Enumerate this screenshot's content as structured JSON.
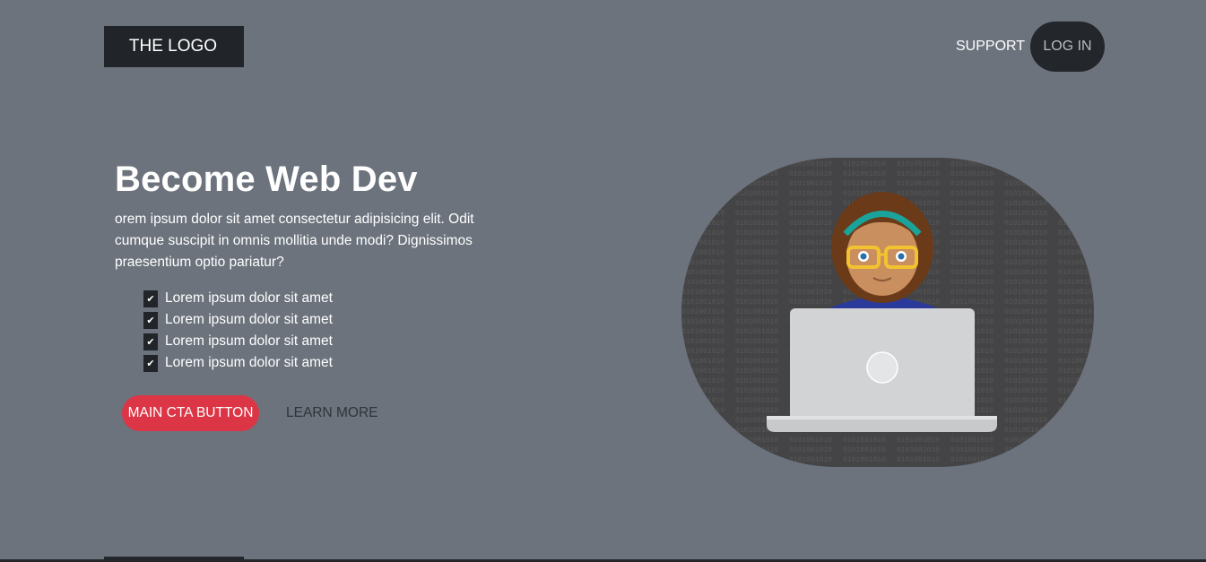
{
  "header": {
    "logo": "THE LOGO",
    "nav": {
      "support": "SUPPORT",
      "login": "LOG IN"
    }
  },
  "hero": {
    "title": "Become Web Dev",
    "description": "orem ipsum dolor sit amet consectetur adipisicing elit. Odit cumque suscipit in omnis mollitia unde modi? Dignissimos praesentium optio pariatur?",
    "features": [
      "Lorem ipsum dolor sit amet",
      "Lorem ipsum dolor sit amet",
      "Lorem ipsum dolor sit amet",
      "Lorem ipsum dolor sit amet"
    ],
    "check_icon": "check-icon",
    "cta_label": "MAIN CTA BUTTON",
    "learn_more_label": "LEARN MORE"
  },
  "colors": {
    "background": "#6c737d",
    "dark": "#212529",
    "accent": "#dc3545"
  }
}
